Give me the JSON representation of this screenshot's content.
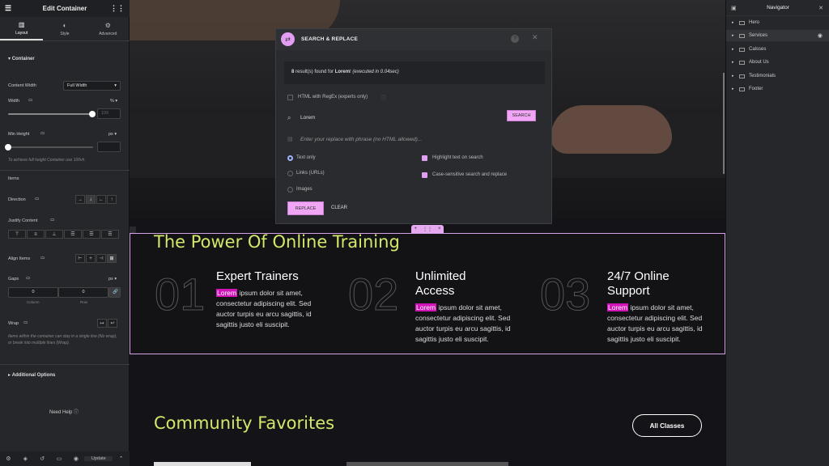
{
  "panel": {
    "title": "Edit Container",
    "tabs": [
      {
        "label": "Layout",
        "icon": "layout-icon"
      },
      {
        "label": "Style",
        "icon": "style-icon"
      },
      {
        "label": "Advanced",
        "icon": "gear-icon"
      }
    ],
    "section_container": "Container",
    "content_width_label": "Content Width",
    "content_width_value": "Full Width",
    "width_label": "Width",
    "width_unit": "%",
    "width_value": "100",
    "min_height_label": "Min Height",
    "min_height_unit": "px",
    "min_height_note": "To achieve full height Container use 100vh.",
    "items_label": "Items",
    "direction_label": "Direction",
    "justify_label": "Justify Content",
    "align_label": "Align Items",
    "gaps_label": "Gaps",
    "gaps_unit": "px",
    "gap_column": "0",
    "gap_row": "0",
    "column_label": "Column",
    "row_label": "Row",
    "wrap_label": "Wrap",
    "wrap_note": "Items within the container can stay in a single line (No wrap), or break into multiple lines (Wrap).",
    "additional": "Additional Options",
    "need_help": "Need Help",
    "update": "Update"
  },
  "dialog": {
    "title": "SEARCH & REPLACE",
    "result_count": "8",
    "result_mid": " result(s) found for ",
    "result_term": "Lorem",
    "result_tail": "! ",
    "result_time": "(executed in 0.04sec)",
    "regex_label": "HTML with RegEx (experts only)",
    "search_value": "Lorem",
    "search_btn": "SEARCH",
    "replace_placeholder": "Enter your replace with phrase (no HTML allowed)...",
    "opt_text": "Text only",
    "opt_links": "Links (URLs)",
    "opt_images": "Images",
    "opt_highlight": "Highlight text on search",
    "opt_case": "Case-sensitive search and replace",
    "replace_btn": "REPLACE",
    "clear_btn": "CLEAR"
  },
  "page": {
    "section_title": "The Power Of Online Training",
    "cols": [
      {
        "num": "01",
        "title1": "Expert Trainers",
        "title2": "",
        "hl": "Lorem",
        "text": " ipsum dolor sit amet, consectetur adipiscing elit. Sed auctor turpis eu arcu sagittis, id sagittis justo eli suscipit."
      },
      {
        "num": "02",
        "title1": "Unlimited",
        "title2": "Access",
        "hl": "Lorem",
        "text": " ipsum dolor sit amet, consectetur adipiscing elit. Sed auctor turpis eu arcu sagittis, id sagittis justo eli suscipit."
      },
      {
        "num": "03",
        "title1": "24/7 Online",
        "title2": "Support",
        "hl": "Lorem",
        "text": " ipsum dolor sit amet, consectetur adipiscing elit. Sed auctor turpis eu arcu sagittis, id sagittis justo eli suscipit."
      }
    ],
    "community_title": "Community Favorites",
    "all_classes": "All Classes"
  },
  "navigator": {
    "title": "Navigator",
    "items": [
      "Hero",
      "Services",
      "Calsses",
      "About Us",
      "Testimonials",
      "Footer"
    ]
  },
  "colors": {
    "accent": "#d2e86a",
    "highlight": "#d014b8",
    "pink": "#f0a6f5"
  }
}
